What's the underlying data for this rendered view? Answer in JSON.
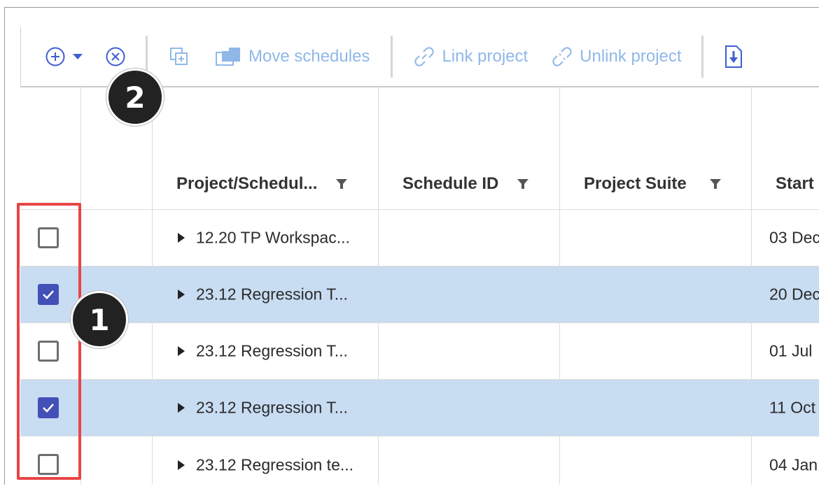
{
  "toolbar": {
    "add_icon": "plus-circle-icon",
    "remove_icon": "x-circle-icon",
    "copy_icon": "copy-schedule-icon",
    "move_label": "Move schedules",
    "link_label": "Link project",
    "unlink_label": "Unlink project",
    "export_icon": "export-icon"
  },
  "columns": [
    {
      "label": "Project/Schedul...",
      "filter": true
    },
    {
      "label": "Schedule ID",
      "filter": true
    },
    {
      "label": "Project Suite",
      "filter": true
    },
    {
      "label": "Start",
      "filter": false
    }
  ],
  "rows": [
    {
      "checked": false,
      "name": "12.20 TP Workspac...",
      "schedule_id": "",
      "suite": "",
      "start": "03 Dec"
    },
    {
      "checked": true,
      "name": "23.12 Regression T...",
      "schedule_id": "",
      "suite": "",
      "start": "20 Dec"
    },
    {
      "checked": false,
      "name": "23.12 Regression T...",
      "schedule_id": "",
      "suite": "",
      "start": "01 Jul"
    },
    {
      "checked": true,
      "name": "23.12 Regression T...",
      "schedule_id": "",
      "suite": "",
      "start": "11 Oct"
    },
    {
      "checked": false,
      "name": "23.12 Regression te...",
      "schedule_id": "",
      "suite": "",
      "start": "04 Jan"
    }
  ],
  "callouts": {
    "one": "1",
    "two": "2"
  },
  "colors": {
    "accent": "#4350b8",
    "selected_row": "#c8dcf2",
    "highlight": "#e84545",
    "disabled_text": "#8fb8e9"
  }
}
